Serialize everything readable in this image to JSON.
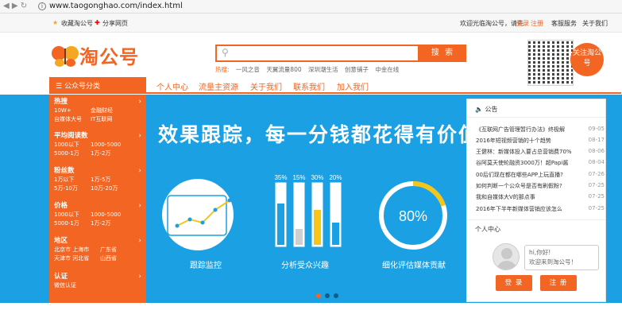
{
  "browser": {
    "url": "www.taogonghao.com/index.html"
  },
  "topbar": {
    "favorite": "收藏淘公号",
    "share": "分享网页",
    "welcome": "欢迎光临淘公号，请先",
    "login": "登录",
    "register": "注册",
    "service": "客服服务",
    "about": "关于我们"
  },
  "logo": {
    "text": "淘公号"
  },
  "search": {
    "button": "搜 索",
    "hot_label": "热搜:",
    "hot_items": [
      "一风之音",
      "天翼流量800",
      "深圳潮生活",
      "创意铺子",
      "中金在线"
    ]
  },
  "qr": {
    "follow": "关注淘公号"
  },
  "nav": {
    "category": "公众号分类",
    "links": [
      "个人中心",
      "流量主资源",
      "关于我们",
      "联系我们",
      "加入我们"
    ]
  },
  "sidebar": [
    {
      "title": "热搜",
      "rows": [
        [
          "10W+",
          "金融财经"
        ],
        [
          "自媒体大号",
          "IT互联网"
        ]
      ]
    },
    {
      "title": "平均阅读数",
      "rows": [
        [
          "1000以下",
          "1000-5000"
        ],
        [
          "5000-1万",
          "1万-2万"
        ]
      ]
    },
    {
      "title": "粉丝数",
      "rows": [
        [
          "1万以下",
          "1万-5万"
        ],
        [
          "5万-10万",
          "10万-20万"
        ]
      ]
    },
    {
      "title": "价格",
      "rows": [
        [
          "1000以下",
          "1000-5000"
        ],
        [
          "5000-1万",
          "1万-2万"
        ]
      ]
    },
    {
      "title": "地区",
      "rows": [
        [
          "北京市 上海市",
          "广东省"
        ],
        [
          "天津市 河北省",
          "山西省"
        ]
      ]
    },
    {
      "title": "认证",
      "rows": [
        [
          "微信认证",
          ""
        ]
      ]
    }
  ],
  "banner": {
    "headline": "效果跟踪，每一分钱都花得有价值",
    "captions": [
      "跟踪监控",
      "分析受众兴趣",
      "细化评估媒体贡献"
    ],
    "progress_label": "80%"
  },
  "chart_data": [
    {
      "type": "bar",
      "categories": [
        "",
        "",
        "",
        ""
      ],
      "values": [
        35,
        15,
        30,
        20
      ],
      "labels": [
        "35%",
        "15%",
        "30%",
        "20%"
      ],
      "ylim": [
        0,
        100
      ]
    },
    {
      "type": "pie",
      "values": [
        80
      ],
      "label": "80%"
    }
  ],
  "colors": {
    "accent": "#f26522",
    "banner": "#1aa0e3",
    "highlight": "#f5c518"
  },
  "announcements": {
    "title": "公告",
    "items": [
      {
        "text": "《互联网广告管理暂行办法》终极解",
        "date": "09-05"
      },
      {
        "text": "2016年短视频营销的十个趋势",
        "date": "08-17"
      },
      {
        "text": "王健林：新媒体投入要占总营销费70%",
        "date": "08-06"
      },
      {
        "text": "谷阿莫天使轮融资3000万！超Papi酱",
        "date": "08-04"
      },
      {
        "text": "00后们现在都在哪些APP上玩直播?",
        "date": "07-26"
      },
      {
        "text": "如何判断一个公众号是否有刷假粉?",
        "date": "07-25"
      },
      {
        "text": "我和自媒体大V的那点事",
        "date": "07-25"
      },
      {
        "text": "2016年下半年新媒体营销应该怎么",
        "date": "07-25"
      }
    ]
  },
  "personal": {
    "title": "个人中心",
    "greeting": "hi,你好!",
    "welcome": "欢迎来到淘公号！",
    "login": "登 录",
    "register": "注 册"
  }
}
